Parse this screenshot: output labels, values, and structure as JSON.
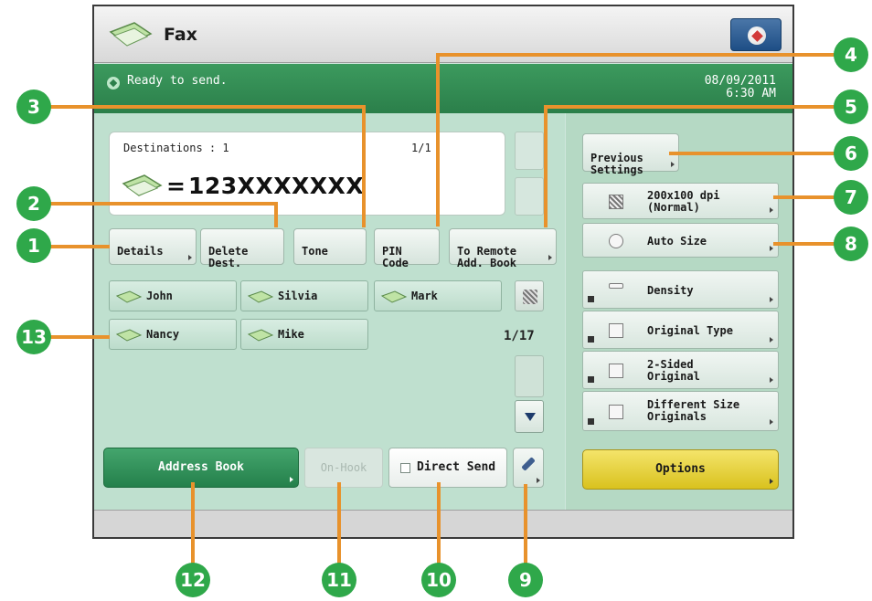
{
  "header": {
    "title": "Fax",
    "menu_icon": "system-menu-icon"
  },
  "status": {
    "message": "Ready to send.",
    "date": "08/09/2011",
    "time": "6:30 AM"
  },
  "destination": {
    "label": "Destinations  : 1",
    "page": "1/1",
    "number": "123XXXXXXX",
    "equals": "="
  },
  "function_buttons": [
    {
      "label": "Details"
    },
    {
      "label": "Delete\nDest."
    },
    {
      "label": "Tone"
    },
    {
      "label": "PIN\nCode"
    },
    {
      "label": "To Remote\nAdd. Book"
    }
  ],
  "one_touch": {
    "items": [
      {
        "label": "John"
      },
      {
        "label": "Silvia"
      },
      {
        "label": "Mark"
      },
      {
        "label": "Nancy"
      },
      {
        "label": "Mike"
      }
    ],
    "page": "1/17"
  },
  "bottom_buttons": {
    "address_book": "Address Book",
    "on_hook": "On-Hook",
    "direct_send": "Direct Send"
  },
  "settings": {
    "previous": "Previous\nSettings",
    "resolution": "200x100 dpi\n(Normal)",
    "size": "Auto Size",
    "density": "Density",
    "original_type": "Original Type",
    "two_sided": "2-Sided\nOriginal",
    "different_size": "Different Size\nOriginals",
    "options": "Options"
  },
  "callouts": [
    "1",
    "2",
    "3",
    "4",
    "5",
    "6",
    "7",
    "8",
    "9",
    "10",
    "11",
    "12",
    "13"
  ],
  "colors": {
    "callout_circle": "#2fa84a",
    "callout_line": "#e8922c",
    "status_bar": "#2b7f4a",
    "options": "#d9c21e"
  }
}
